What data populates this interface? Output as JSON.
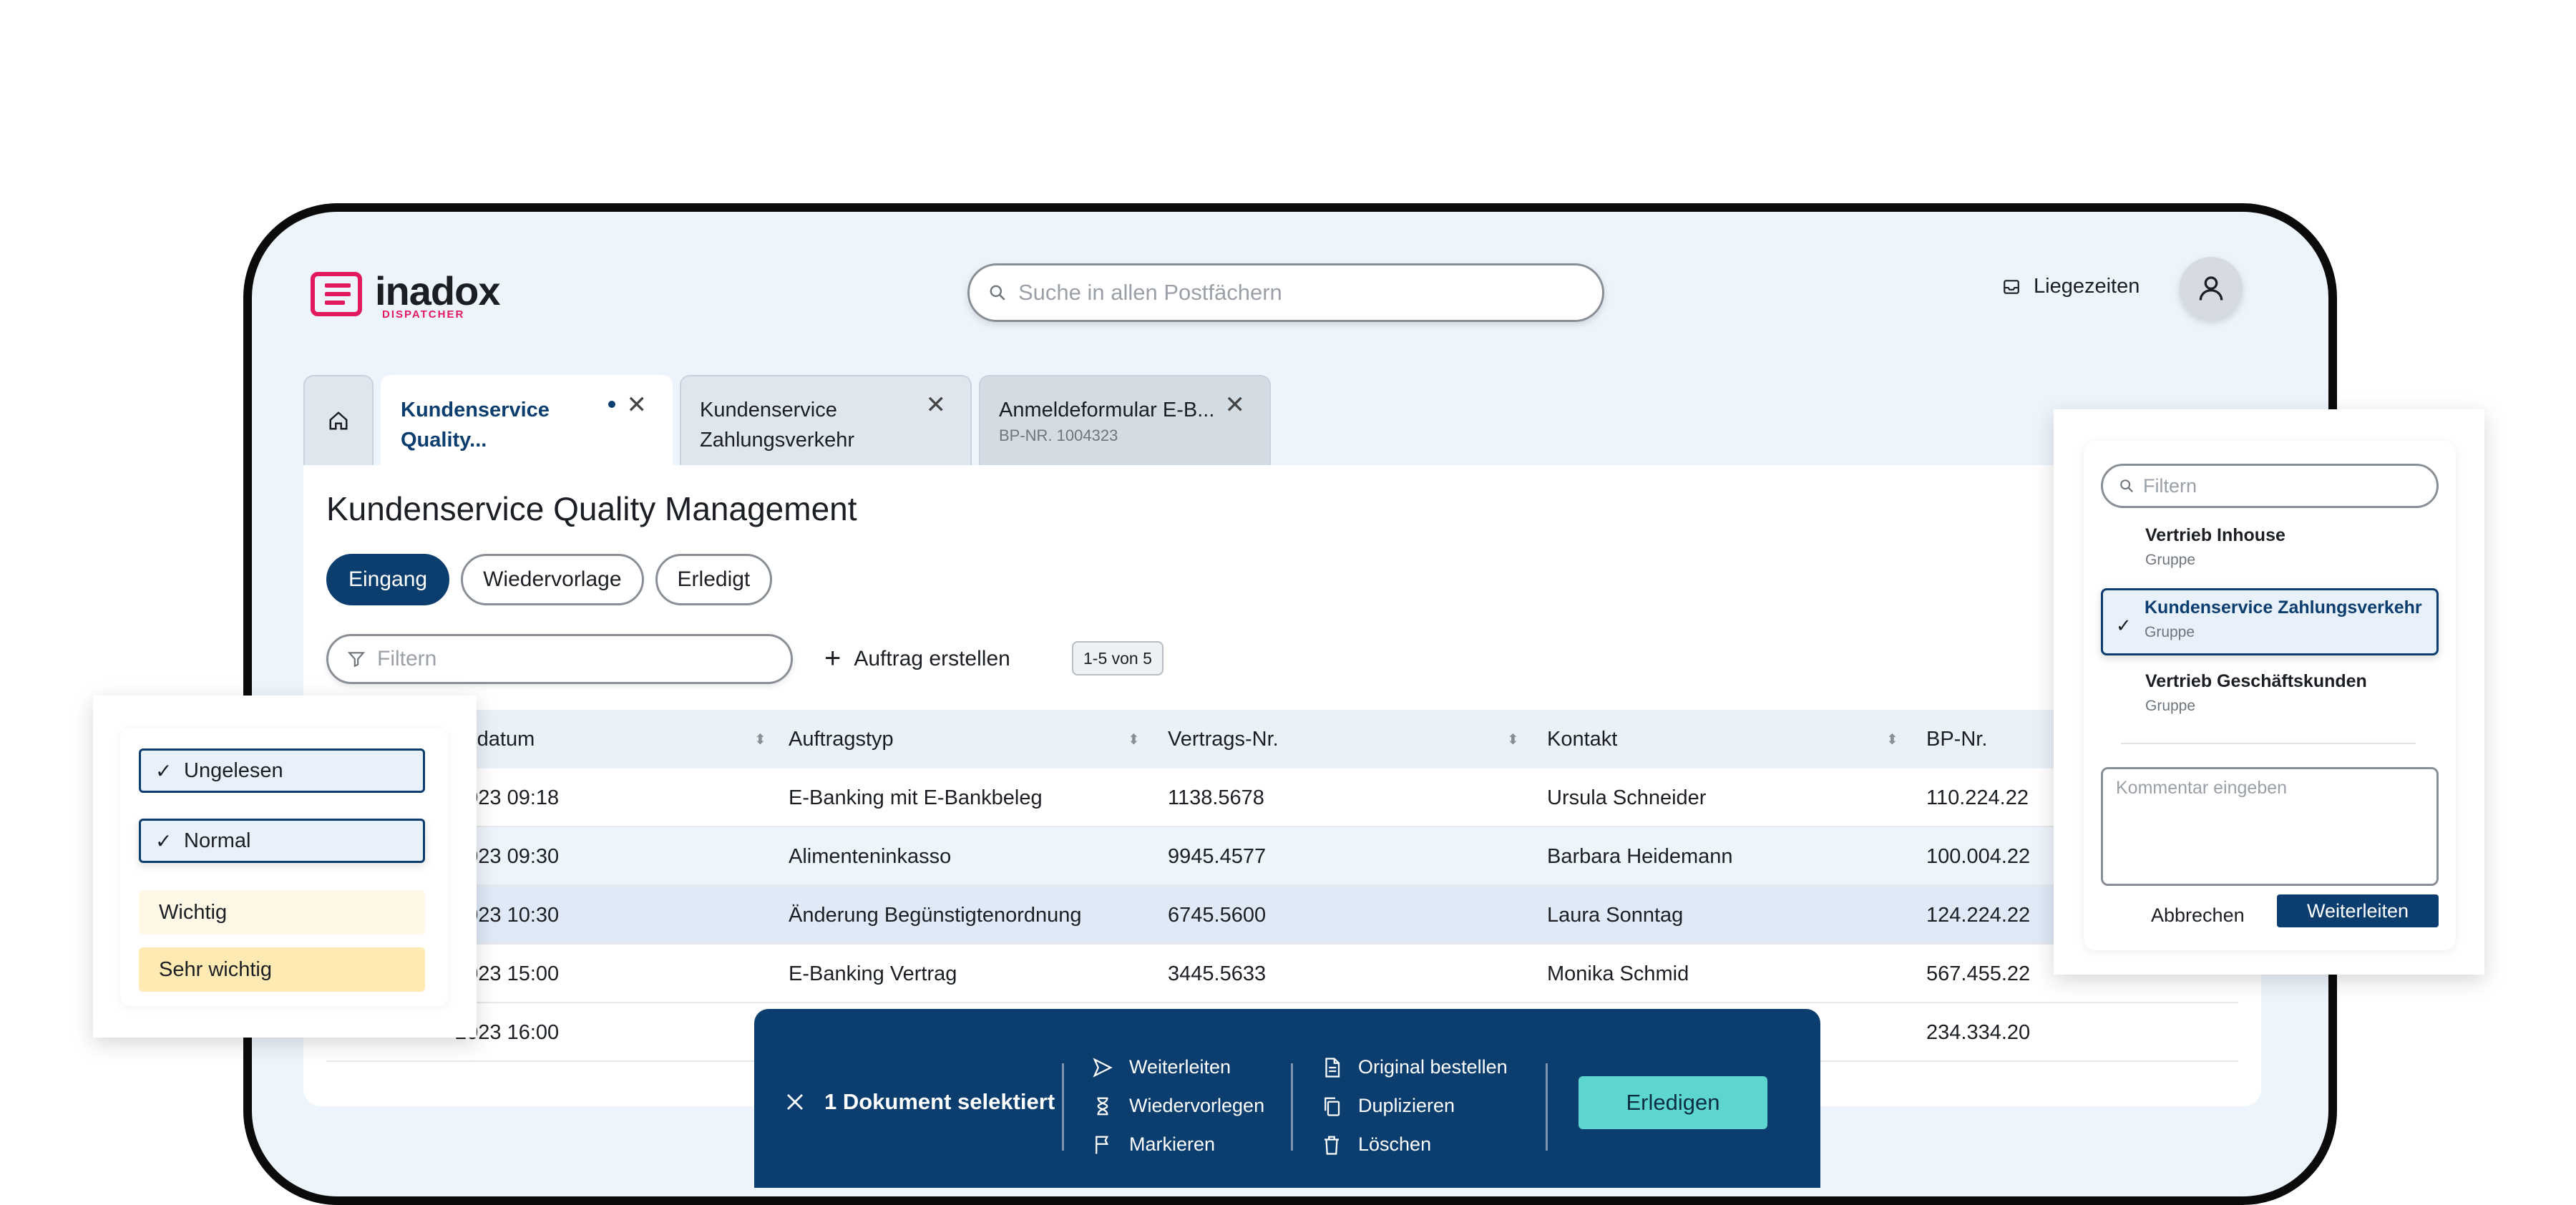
{
  "logo": {
    "name": "inadox",
    "sub": "DISPATCHER"
  },
  "search": {
    "placeholder": "Suche in allen Postfächern"
  },
  "header": {
    "liegezeiten": "Liegezeiten"
  },
  "tabs": [
    {
      "label": "Kundenservice Quality...",
      "line1": "Kundenservice",
      "line2": "Quality...",
      "close": "✕"
    },
    {
      "line1": "Kundenservice",
      "line2": "Zahlungsverkehr",
      "close": "✕"
    },
    {
      "line1": "Anmeldeformular E-B...",
      "sub": "BP-NR. 1004323",
      "close": "✕"
    }
  ],
  "page": {
    "title": "Kundenservice Quality Management"
  },
  "views": [
    "Eingang",
    "Wiedervorlage",
    "Erledigt"
  ],
  "filter": {
    "placeholder": "Filtern"
  },
  "create_label": "Auftrag erstellen",
  "count_label": "1-5 von 5",
  "table": {
    "headers": [
      "gsdatum",
      "Auftragstyp",
      "Vertrags-Nr.",
      "Kontakt",
      "BP-Nr."
    ],
    "rows": [
      [
        "2023 09:18",
        "E-Banking mit E-Bankbeleg",
        "1138.5678",
        "Ursula Schneider",
        "110.224.22"
      ],
      [
        "2023 09:30",
        "Alimenteninkasso",
        "9945.4577",
        "Barbara Heidemann",
        "100.004.22"
      ],
      [
        "2023 10:30",
        "Änderung Begünstigtenordnung",
        "6745.5600",
        "Laura Sonntag",
        "124.224.22"
      ],
      [
        "2023 15:00",
        "E-Banking Vertrag",
        "3445.5633",
        "Monika Schmid",
        "567.455.22"
      ],
      [
        "2023 16:00",
        "",
        "",
        "",
        "234.334.20"
      ]
    ]
  },
  "priority": {
    "options": [
      "Ungelesen",
      "Normal",
      "Wichtig",
      "Sehr wichtig"
    ],
    "colors": {
      "checked": "#e8f0fa",
      "wichtig": "#fff8e6",
      "sehr_wichtig": "#ffeab4"
    }
  },
  "forward_panel": {
    "filter_placeholder": "Filtern",
    "options": [
      {
        "name": "Vertrieb Inhouse",
        "type": "Gruppe"
      },
      {
        "name": "Kundenservice Zahlungsverkehr",
        "type": "Gruppe"
      },
      {
        "name": "Vertrieb Geschäftskunden",
        "type": "Gruppe"
      }
    ],
    "comment_placeholder": "Kommentar eingeben",
    "cancel": "Abbrechen",
    "submit": "Weiterleiten"
  },
  "action_bar": {
    "selected": "1 Dokument selektiert",
    "col1": [
      "Weiterleiten",
      "Wiedervorlegen",
      "Markieren"
    ],
    "col2": [
      "Original bestellen",
      "Duplizieren",
      "Löschen"
    ],
    "done": "Erledigen"
  },
  "colors": {
    "brand": "#e3195d",
    "primary": "#0b3d6e",
    "accent": "#5cd6cf",
    "bg": "#edf4fc"
  }
}
